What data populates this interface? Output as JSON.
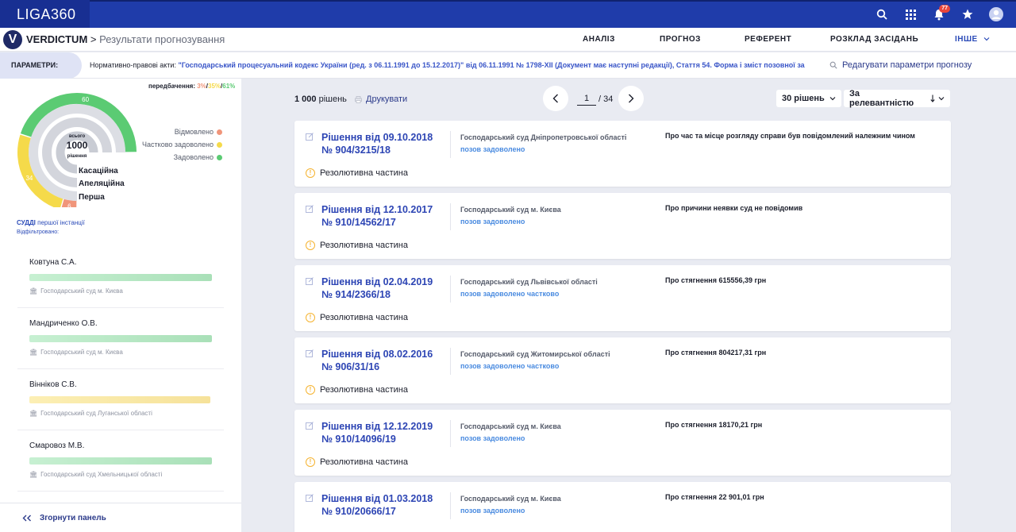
{
  "app": {
    "logo": "LIGA360",
    "notification_count": "77"
  },
  "nav": {
    "v_letter": "V",
    "brand": "VERDICTUM",
    "separator": ">",
    "page_title": "Результати прогнозування",
    "links": [
      "АНАЛІЗ",
      "ПРОГНОЗ",
      "РЕФЕРЕНТ",
      "РОЗКЛАД ЗАСІДАНЬ",
      "ІНШЕ"
    ]
  },
  "params": {
    "tab_label": "ПАРАМЕТРИ:",
    "prefix": "Нормативно-правові акти:",
    "link_text": "\"Господарський процесуальний кодекс України (ред. з 06.11.1991 до 15.12.2017)\" від 06.11.1991 № 1798-XII (Документ має наступні редакції), Стаття 54. Форма і зміст позовної за",
    "edit_label": "Редагувати параметри прогнозу"
  },
  "prediction": {
    "label": "передбачення:",
    "red_pct": "3%",
    "yellow_pct": "35%",
    "green_pct": "61%",
    "center_top": "всього",
    "center_value": "1000",
    "center_bottom": "рішення",
    "outer_values": {
      "green": 60,
      "yellow": 34,
      "red": 6
    },
    "legend": [
      {
        "label": "Відмовлено",
        "color": "#f0957a"
      },
      {
        "label": "Частково задоволено",
        "color": "#f5da4a"
      },
      {
        "label": "Задоволено",
        "color": "#5bcb73"
      }
    ],
    "instances": [
      "Касаційна",
      "Апеляційна",
      "Перша"
    ]
  },
  "judges": {
    "title": "СУДДІ",
    "subtitle": "першої інстанції",
    "filtered": "Відфільтровано:",
    "items": [
      {
        "name": "Ковтуна С.А.",
        "court": "Господарський суд м. Києва",
        "color": "#bfeccb"
      },
      {
        "name": "Мандриченко О.В.",
        "court": "Господарський суд м. Києва",
        "color": "#bfeccb"
      },
      {
        "name": "Вінніков С.В.",
        "court": "Господарський суд Луганської області",
        "color": "#fbe8a6"
      },
      {
        "name": "Смаровоз М.В.",
        "court": "Господарський суд Хмельницької області",
        "color": "#bfeccb"
      }
    ],
    "collapse_label": "Згорнути панель"
  },
  "results": {
    "count_value": "1 000",
    "count_label": "рішень",
    "print_label": "Друкувати",
    "page_current": "1",
    "page_total": "/ 34",
    "per_page": "30 рішень",
    "sort": "За релевантністю",
    "part_label": "Резолютивна частина",
    "cards": [
      {
        "title1": "Рішення від 09.10.2018",
        "title2": "№ 904/3215/18",
        "court": "Господарський суд Дніпропетровської області",
        "status": "позов задоволено",
        "desc": "Про час та місце розгляду справи був повідомлений належним чином"
      },
      {
        "title1": "Рішення від 12.10.2017",
        "title2": "№ 910/14562/17",
        "court": "Господарський суд м. Києва",
        "status": "позов задоволено",
        "desc": "Про причини неявки суд не повідомив"
      },
      {
        "title1": "Рішення від 02.04.2019",
        "title2": "№ 914/2366/18",
        "court": "Господарський суд Львівської області",
        "status": "позов задоволено частково",
        "desc": "Про стягнення 615556,39 грн"
      },
      {
        "title1": "Рішення від 08.02.2016",
        "title2": "№ 906/31/16",
        "court": "Господарський суд Житомирської області",
        "status": "позов задоволено частково",
        "desc": "Про стягнення 804217,31 грн"
      },
      {
        "title1": "Рішення від 12.12.2019",
        "title2": "№ 910/14096/19",
        "court": "Господарський суд м. Києва",
        "status": "позов задоволено",
        "desc": "Про стягнення 18170,21 грн"
      },
      {
        "title1": "Рішення від 01.03.2018",
        "title2": "№ 910/20666/17",
        "court": "Господарський суд м. Києва",
        "status": "позов задоволено",
        "desc": "Про стягнення 22 901,01 грн"
      }
    ]
  }
}
